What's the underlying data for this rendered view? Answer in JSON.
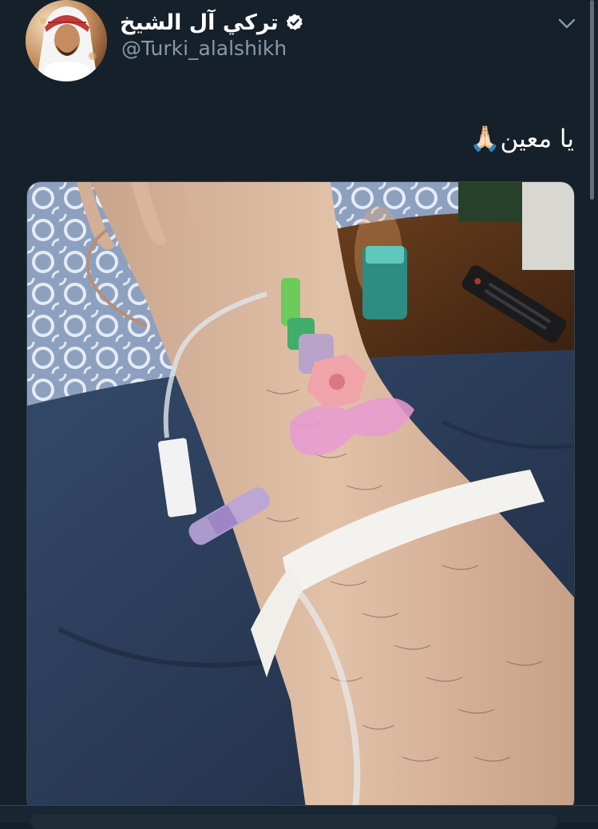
{
  "tweet": {
    "author": {
      "display_name": "تركي آل الشيخ",
      "handle": "@Turki_alalshikh",
      "verified": true,
      "avatar_icon": "profile-photo"
    },
    "text": "يا معين🙏🏻",
    "media": {
      "type": "photo"
    },
    "menu_icon": "chevron-down-icon"
  },
  "theme": {
    "background": "#15202b",
    "text": "#ffffff",
    "secondary_text": "#8899a6",
    "verified_badge": "#ffffff"
  }
}
